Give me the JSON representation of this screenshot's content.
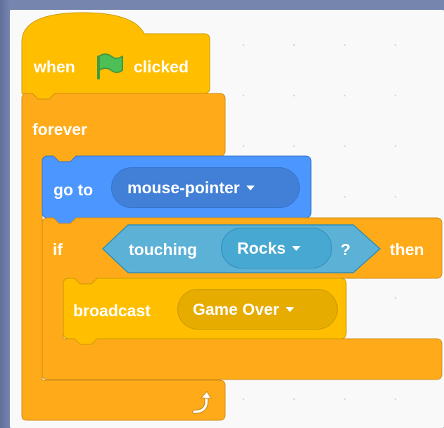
{
  "script": {
    "hat": {
      "prefix": "when",
      "suffix": "clicked",
      "icon": "green-flag-icon"
    },
    "forever": {
      "label": "forever",
      "icon": "loop-arrow-icon"
    },
    "goto": {
      "label": "go to",
      "target": "mouse-pointer"
    },
    "if": {
      "label": "if",
      "then_label": "then"
    },
    "touching": {
      "label": "touching",
      "object": "Rocks",
      "question": "?"
    },
    "broadcast": {
      "label": "broadcast",
      "message": "Game Over"
    }
  },
  "colors": {
    "events": "#ffbf00",
    "control": "#ffab19",
    "motion": "#4c97ff",
    "sensing": "#5cb1d6",
    "flag": "#4cbf56"
  }
}
